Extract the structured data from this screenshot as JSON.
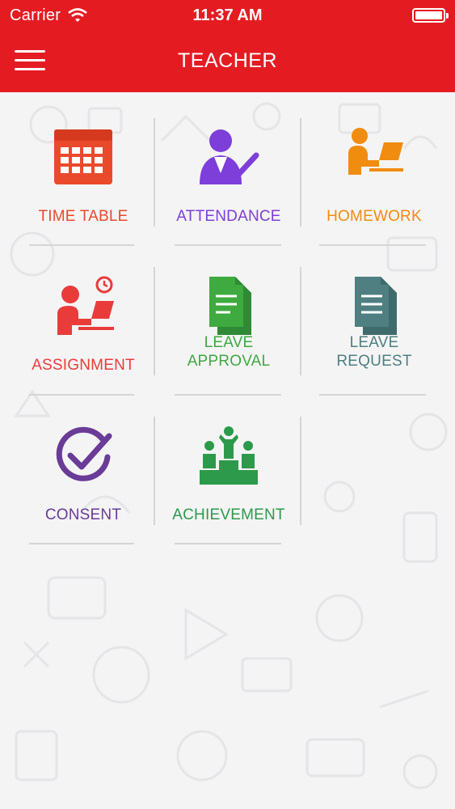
{
  "status_bar": {
    "carrier": "Carrier",
    "time": "11:37 AM"
  },
  "header": {
    "title": "TEACHER",
    "menu_icon": "hamburger-menu-icon"
  },
  "colors": {
    "header": "#e41c22",
    "timetable": "#ea4a2c",
    "attendance": "#7e3ed9",
    "homework": "#f08c10",
    "assignment": "#ea3b3b",
    "leave_approval": "#3faa3f",
    "leave_request": "#4f7f80",
    "consent": "#6a3b97",
    "achievement": "#2c9a4a"
  },
  "tiles": [
    {
      "label": "TIME TABLE",
      "icon": "calendar-icon"
    },
    {
      "label": "ATTENDANCE",
      "icon": "attendance-check-icon"
    },
    {
      "label": "HOMEWORK",
      "icon": "student-laptop-icon"
    },
    {
      "label": "ASSIGNMENT",
      "icon": "person-laptop-clock-icon"
    },
    {
      "label": "LEAVE\nAPPROVAL",
      "icon": "documents-green-icon"
    },
    {
      "label": "LEAVE\nREQUEST",
      "icon": "documents-grey-icon"
    },
    {
      "label": "CONSENT",
      "icon": "checkmark-circle-icon"
    },
    {
      "label": "ACHIEVEMENT",
      "icon": "podium-winners-icon"
    }
  ]
}
